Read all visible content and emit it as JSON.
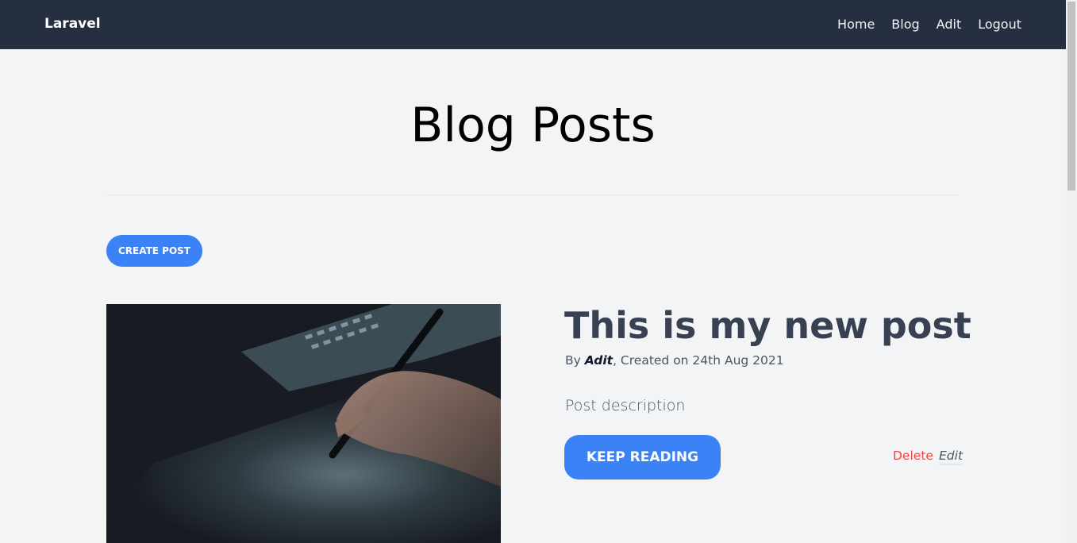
{
  "nav": {
    "brand": "Laravel",
    "links": [
      {
        "label": "Home"
      },
      {
        "label": "Blog"
      },
      {
        "label": "Adit"
      },
      {
        "label": "Logout"
      }
    ]
  },
  "page": {
    "title": "Blog Posts",
    "create_button": "CREATE POST"
  },
  "post": {
    "title": "This is my new post",
    "by_prefix": "By ",
    "author": "Adit",
    "created_text": ", Created on 24th Aug 2021",
    "description": "Post description",
    "keep_reading": "KEEP READING",
    "delete": "Delete",
    "edit": "Edit",
    "image_icon": "hand-writing-on-tablet-photo"
  },
  "colors": {
    "nav_bg": "#252f3f",
    "accent": "#3b82f6",
    "delete": "#ef4444",
    "page_bg": "#f3f4f6"
  }
}
